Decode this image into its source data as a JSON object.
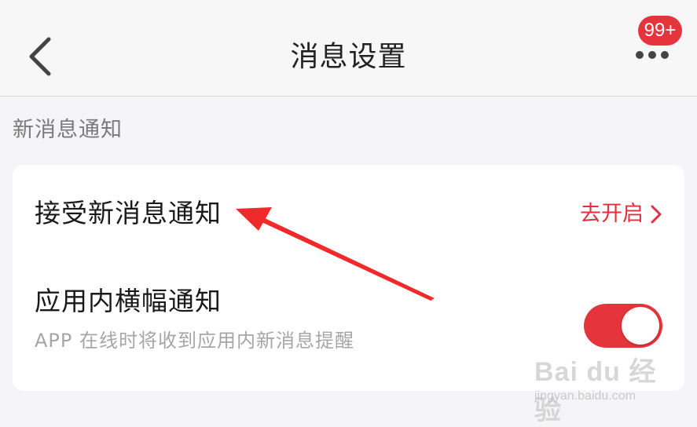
{
  "header": {
    "title": "消息设置",
    "badge": "99+",
    "back_icon": "chevron-left-icon",
    "more_icon": "more-dots-icon"
  },
  "section": {
    "label": "新消息通知"
  },
  "rows": {
    "accept": {
      "title": "接受新消息通知",
      "action_label": "去开启",
      "action_icon": "chevron-right-icon"
    },
    "banner": {
      "title": "应用内横幅通知",
      "subtitle": "APP 在线时将收到应用内新消息提醒",
      "enabled": true
    }
  },
  "watermark": {
    "brand": "Bai du 经验",
    "url": "jingyan.baidu.com"
  },
  "colors": {
    "accent": "#e6343d",
    "background": "#f5f5f7",
    "card": "#ffffff",
    "arrow": "#f02a2a"
  }
}
